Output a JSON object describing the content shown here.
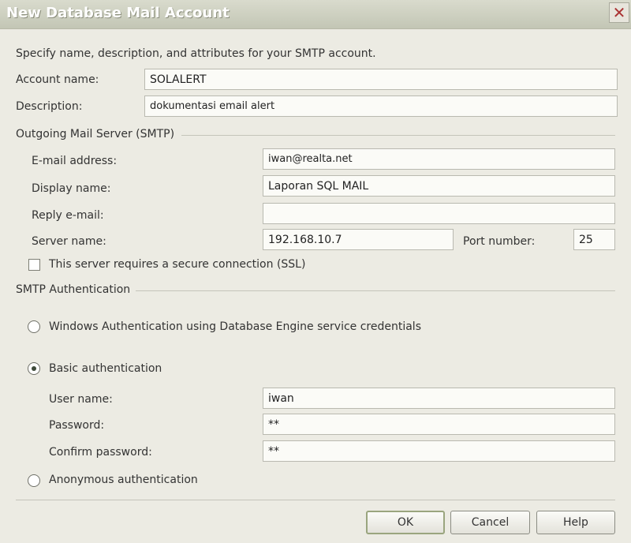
{
  "window": {
    "title": "New Database Mail Account",
    "close_glyph": "✕",
    "close_icon": "close-icon"
  },
  "intro": "Specify name, description, and attributes for your SMTP account.",
  "account": {
    "name_label": "Account name:",
    "name_value": "SOLALERT",
    "description_label": "Description:",
    "description_value": "dokumentasi email alert"
  },
  "smtp": {
    "section_label": "Outgoing Mail Server (SMTP)",
    "email_label": "E-mail address:",
    "email_value": "iwan@realta.net",
    "display_label": "Display name:",
    "display_value": "Laporan SQL MAIL",
    "reply_label": "Reply e-mail:",
    "reply_value": "",
    "server_label": "Server name:",
    "server_value": "192.168.10.7",
    "port_label": "Port number:",
    "port_value": "25",
    "ssl_label": "This server requires a secure connection (SSL)",
    "ssl_checked": false
  },
  "auth": {
    "section_label": "SMTP Authentication",
    "windows_label": "Windows Authentication using Database Engine service credentials",
    "basic_label": "Basic authentication",
    "selected": "basic",
    "username_label": "User name:",
    "username_value": "iwan",
    "password_label": "Password:",
    "password_value": "**",
    "confirm_label": "Confirm password:",
    "confirm_value": "**",
    "anonymous_label": "Anonymous authentication"
  },
  "buttons": {
    "ok": "OK",
    "cancel": "Cancel",
    "help": "Help"
  }
}
